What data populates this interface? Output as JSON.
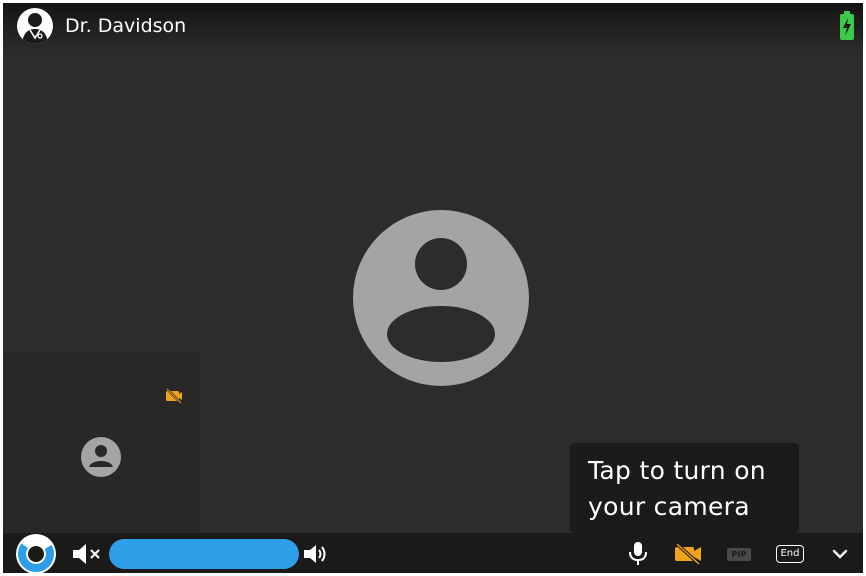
{
  "header": {
    "caller_name": "Dr. Davidson",
    "avatar_icon": "doctor-avatar-icon",
    "battery_icon": "battery-charging-icon",
    "battery_color": "#3cc84a"
  },
  "main": {
    "remote_avatar_icon": "user-placeholder-icon"
  },
  "self_view": {
    "camera_status_icon": "camera-off-icon",
    "avatar_icon": "user-placeholder-icon",
    "accent_color": "#f0a21a"
  },
  "tooltip": {
    "line1": "Tap to turn on",
    "line2": "your camera"
  },
  "controls": {
    "logo_icon": "app-logo-icon",
    "mute_icon": "speaker-muted-icon",
    "volume_icon": "speaker-icon",
    "volume_level": 1.0,
    "volume_color": "#2d9ee8",
    "mic_icon": "microphone-icon",
    "camera_icon": "camera-off-icon",
    "pip_label": "PIP",
    "end_label": "End",
    "more_icon": "chevron-down-icon"
  }
}
